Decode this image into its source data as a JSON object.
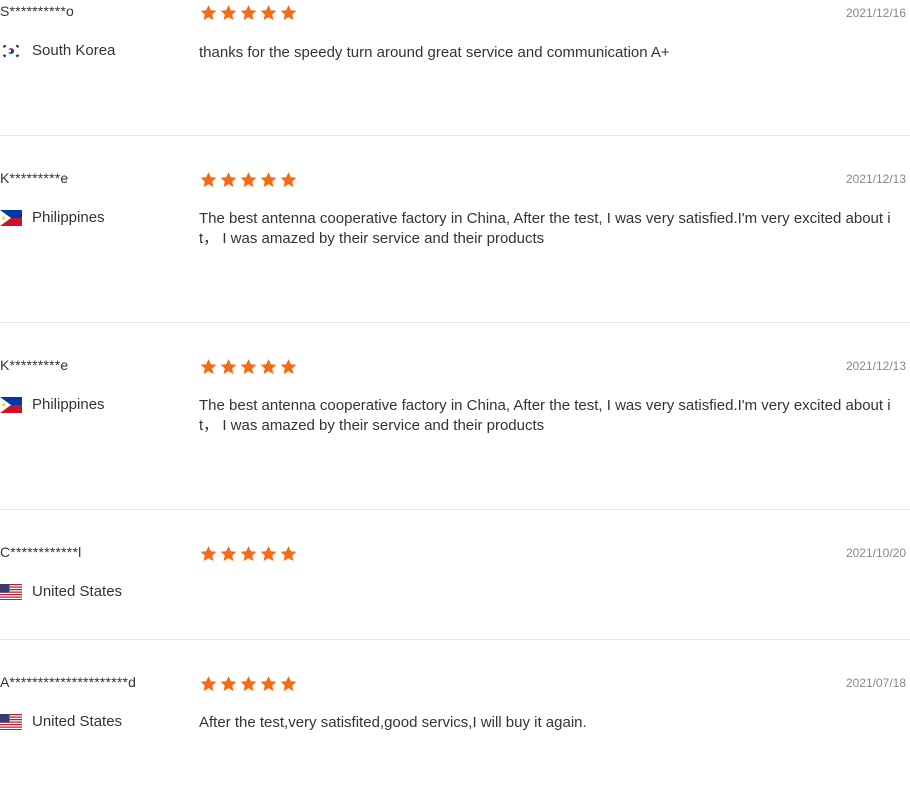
{
  "colors": {
    "star": "#f56a14",
    "divider": "#e8e8e8",
    "date": "#888888",
    "text": "#333333"
  },
  "reviews": [
    {
      "name": "S**********o",
      "country": "South Korea",
      "flag_icon": "south-korea-flag-icon",
      "rating": 5,
      "date": "2021/12/16",
      "text": "thanks for the speedy turn around great service and communication A+"
    },
    {
      "name": "K*********e",
      "country": "Philippines",
      "flag_icon": "philippines-flag-icon",
      "rating": 5,
      "date": "2021/12/13",
      "text": "The best antenna cooperative factory in China, After the test, I was very satisfied.I'm very excited about it， I was amazed by their service and their products"
    },
    {
      "name": "K*********e",
      "country": "Philippines",
      "flag_icon": "philippines-flag-icon",
      "rating": 5,
      "date": "2021/12/13",
      "text": "The best antenna cooperative factory in China, After the test, I was very satisfied.I'm very excited about it， I was amazed by their service and their products"
    },
    {
      "name": "C************l",
      "country": "United States",
      "flag_icon": "united-states-flag-icon",
      "rating": 5,
      "date": "2021/10/20",
      "text": ""
    },
    {
      "name": "A*********************d",
      "country": "United States",
      "flag_icon": "united-states-flag-icon",
      "rating": 5,
      "date": "2021/07/18",
      "text": "After the test,very satisfited,good servics,I will buy it again."
    }
  ]
}
